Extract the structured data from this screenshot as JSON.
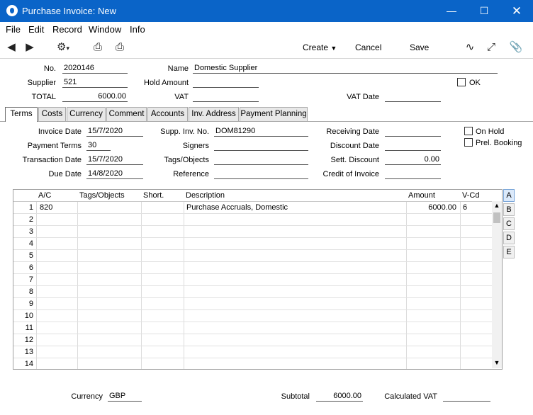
{
  "window": {
    "title": "Purchase Invoice: New"
  },
  "menu": [
    "File",
    "Edit",
    "Record",
    "Window",
    "Info"
  ],
  "toolbar": {
    "create": "Create",
    "cancel": "Cancel",
    "save": "Save"
  },
  "header": {
    "no_label": "No.",
    "no_value": "2020146",
    "supplier_label": "Supplier",
    "supplier_value": "521",
    "total_label": "TOTAL",
    "total_value": "6000.00",
    "name_label": "Name",
    "name_value": "Domestic Supplier",
    "hold_amount_label": "Hold Amount",
    "hold_amount_value": "",
    "vat_label": "VAT",
    "vat_value": "",
    "vat_date_label": "VAT Date",
    "vat_date_value": "",
    "ok_label": "OK"
  },
  "tabs": [
    "Terms",
    "Costs",
    "Currency",
    "Comment",
    "Accounts",
    "Inv. Address",
    "Payment Planning"
  ],
  "terms": {
    "invoice_date_label": "Invoice Date",
    "invoice_date_value": "15/7/2020",
    "payment_terms_label": "Payment Terms",
    "payment_terms_value": "30",
    "transaction_date_label": "Transaction Date",
    "transaction_date_value": "15/7/2020",
    "due_date_label": "Due Date",
    "due_date_value": "14/8/2020",
    "supp_inv_no_label": "Supp. Inv. No.",
    "supp_inv_no_value": "DOM81290",
    "signers_label": "Signers",
    "signers_value": "",
    "tags_label": "Tags/Objects",
    "tags_value": "",
    "reference_label": "Reference",
    "reference_value": "",
    "receiving_date_label": "Receiving Date",
    "receiving_date_value": "",
    "discount_date_label": "Discount Date",
    "discount_date_value": "",
    "sett_discount_label": "Sett. Discount",
    "sett_discount_value": "0.00",
    "credit_of_invoice_label": "Credit of Invoice",
    "credit_of_invoice_value": "",
    "on_hold_label": "On Hold",
    "prel_booking_label": "Prel. Booking"
  },
  "grid": {
    "columns": [
      "A/C",
      "Tags/Objects",
      "Short.",
      "Description",
      "Amount",
      "V-Cd"
    ],
    "rows": [
      {
        "n": "1",
        "ac": "820",
        "tags": "",
        "short": "",
        "desc": "Purchase Accruals, Domestic",
        "amount": "6000.00",
        "vcd": "6"
      },
      {
        "n": "2",
        "ac": "",
        "tags": "",
        "short": "",
        "desc": "",
        "amount": "",
        "vcd": ""
      },
      {
        "n": "3",
        "ac": "",
        "tags": "",
        "short": "",
        "desc": "",
        "amount": "",
        "vcd": ""
      },
      {
        "n": "4",
        "ac": "",
        "tags": "",
        "short": "",
        "desc": "",
        "amount": "",
        "vcd": ""
      },
      {
        "n": "5",
        "ac": "",
        "tags": "",
        "short": "",
        "desc": "",
        "amount": "",
        "vcd": ""
      },
      {
        "n": "6",
        "ac": "",
        "tags": "",
        "short": "",
        "desc": "",
        "amount": "",
        "vcd": ""
      },
      {
        "n": "7",
        "ac": "",
        "tags": "",
        "short": "",
        "desc": "",
        "amount": "",
        "vcd": ""
      },
      {
        "n": "8",
        "ac": "",
        "tags": "",
        "short": "",
        "desc": "",
        "amount": "",
        "vcd": ""
      },
      {
        "n": "9",
        "ac": "",
        "tags": "",
        "short": "",
        "desc": "",
        "amount": "",
        "vcd": ""
      },
      {
        "n": "10",
        "ac": "",
        "tags": "",
        "short": "",
        "desc": "",
        "amount": "",
        "vcd": ""
      },
      {
        "n": "11",
        "ac": "",
        "tags": "",
        "short": "",
        "desc": "",
        "amount": "",
        "vcd": ""
      },
      {
        "n": "12",
        "ac": "",
        "tags": "",
        "short": "",
        "desc": "",
        "amount": "",
        "vcd": ""
      },
      {
        "n": "13",
        "ac": "",
        "tags": "",
        "short": "",
        "desc": "",
        "amount": "",
        "vcd": ""
      },
      {
        "n": "14",
        "ac": "",
        "tags": "",
        "short": "",
        "desc": "",
        "amount": "",
        "vcd": ""
      }
    ],
    "side_tabs": [
      "A",
      "B",
      "C",
      "D",
      "E"
    ]
  },
  "footer": {
    "currency_label": "Currency",
    "currency_value": "GBP",
    "subtotal_label": "Subtotal",
    "subtotal_value": "6000.00",
    "calculated_vat_label": "Calculated VAT",
    "calculated_vat_value": ""
  }
}
